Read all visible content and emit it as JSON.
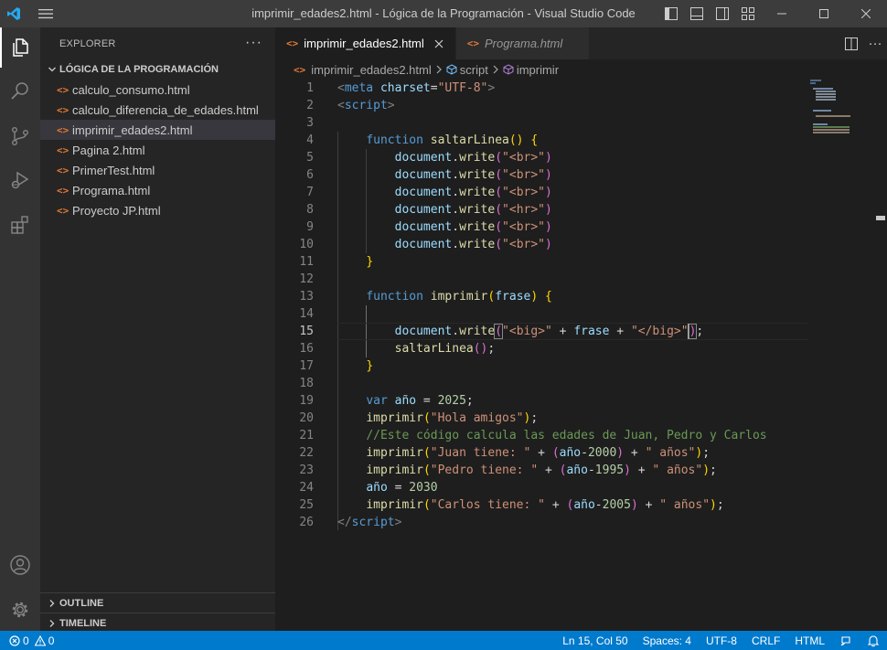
{
  "window": {
    "title": "imprimir_edades2.html - Lógica de la Programación - Visual Studio Code"
  },
  "explorer": {
    "header": "EXPLORER",
    "more": "···",
    "folder": "LÓGICA DE LA PROGRAMACIÓN",
    "files": [
      {
        "name": "calculo_consumo.html"
      },
      {
        "name": "calculo_diferencia_de_edades.html"
      },
      {
        "name": "imprimir_edades2.html"
      },
      {
        "name": "Pagina 2.html"
      },
      {
        "name": "PrimerTest.html"
      },
      {
        "name": "Programa.html"
      },
      {
        "name": "Proyecto JP.html"
      }
    ],
    "file_icon": "<>",
    "outline": "OUTLINE",
    "timeline": "TIMELINE"
  },
  "tabs": [
    {
      "label": "imprimir_edades2.html",
      "active": true
    },
    {
      "label": "Programa.html",
      "active": false
    }
  ],
  "breadcrumb": {
    "file": "imprimir_edades2.html",
    "node1": "script",
    "node2": "imprimir"
  },
  "editor": {
    "line_numbers": [
      "1",
      "2",
      "3",
      "4",
      "5",
      "6",
      "7",
      "8",
      "9",
      "10",
      "11",
      "12",
      "13",
      "14",
      "15",
      "16",
      "17",
      "18",
      "19",
      "20",
      "21",
      "22",
      "23",
      "24",
      "25",
      "26"
    ],
    "current_line": 15
  },
  "status": {
    "errors": "0",
    "warnings": "0",
    "position": "Ln 15, Col 50",
    "spaces": "Spaces: 4",
    "encoding": "UTF-8",
    "eol": "CRLF",
    "language": "HTML"
  },
  "colors": {
    "accent": "#007acc",
    "titlebar": "#3c3c3c",
    "activitybar": "#333333",
    "sidebar": "#252526",
    "editor": "#1e1e1e"
  },
  "icons": {
    "logo": "vscode-logo-icon",
    "menu": "hamburger-menu-icon",
    "explorer": "files-icon",
    "search": "search-icon",
    "scm": "source-control-icon",
    "debug": "run-debug-icon",
    "extensions": "extensions-icon",
    "account": "account-icon",
    "settings": "gear-icon"
  }
}
